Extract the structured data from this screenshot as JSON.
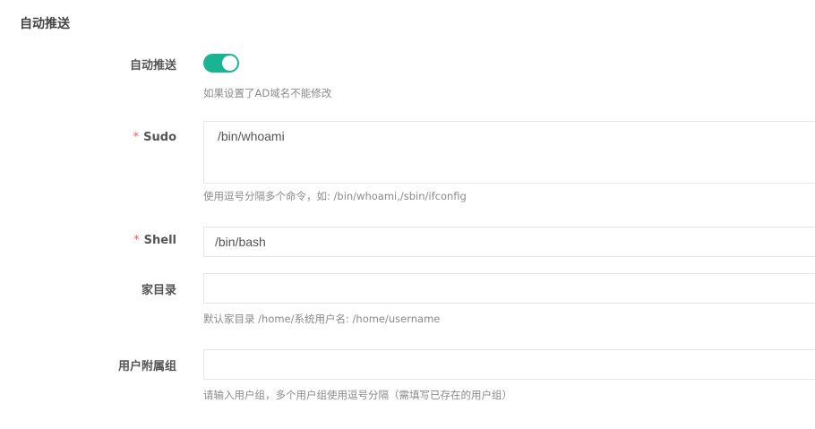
{
  "section": {
    "title": "自动推送"
  },
  "fields": {
    "auto_push": {
      "label": "自动推送",
      "enabled": true,
      "help": "如果设置了AD域名不能修改"
    },
    "sudo": {
      "required_mark": "*",
      "label": "Sudo",
      "value": "/bin/whoami",
      "help": "使用逗号分隔多个命令，如: /bin/whoami,/sbin/ifconfig"
    },
    "shell": {
      "required_mark": "*",
      "label": "Shell",
      "value": "/bin/bash"
    },
    "home_dir": {
      "label": "家目录",
      "value": "",
      "help": "默认家目录 /home/系统用户名: /home/username"
    },
    "groups": {
      "label": "用户附属组",
      "value": "",
      "help": "请输入用户组，多个用户组使用逗号分隔（需填写已存在的用户组）"
    }
  },
  "colors": {
    "accent": "#1ab394",
    "required": "#ed5565"
  }
}
